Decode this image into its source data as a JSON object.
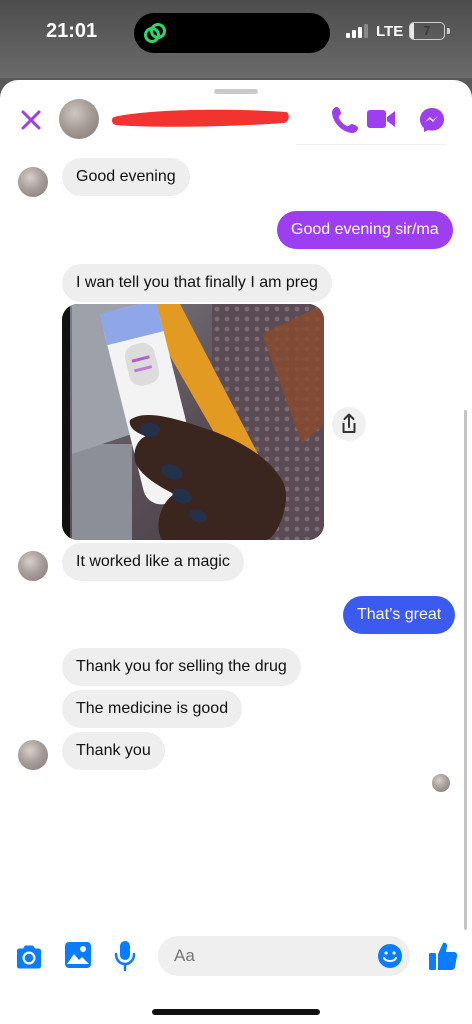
{
  "status_bar": {
    "time": "21:01",
    "network": "LTE",
    "battery": "7",
    "battery_level": 0.07
  },
  "chat": {
    "contact_name_visible": false,
    "accent_color": "#9d3ff0",
    "outgoing_blue": "#3a5af0",
    "icons": [
      "close-icon",
      "phone-icon",
      "video-camera-icon",
      "messenger-icon",
      "share-icon",
      "camera-icon",
      "gallery-icon",
      "microphone-icon",
      "emoji-icon",
      "thumbs-up-icon"
    ]
  },
  "messages": {
    "m1": "Good evening",
    "m2": "Good evening sir/ma",
    "m3": "I wan tell you that finally I am preg",
    "m4": "It worked like a magic",
    "m5": "That’s great",
    "m6": "Thank you for selling the drug",
    "m7": "The medicine is good",
    "m8": "Thank you"
  },
  "composer": {
    "placeholder": "Aa"
  }
}
